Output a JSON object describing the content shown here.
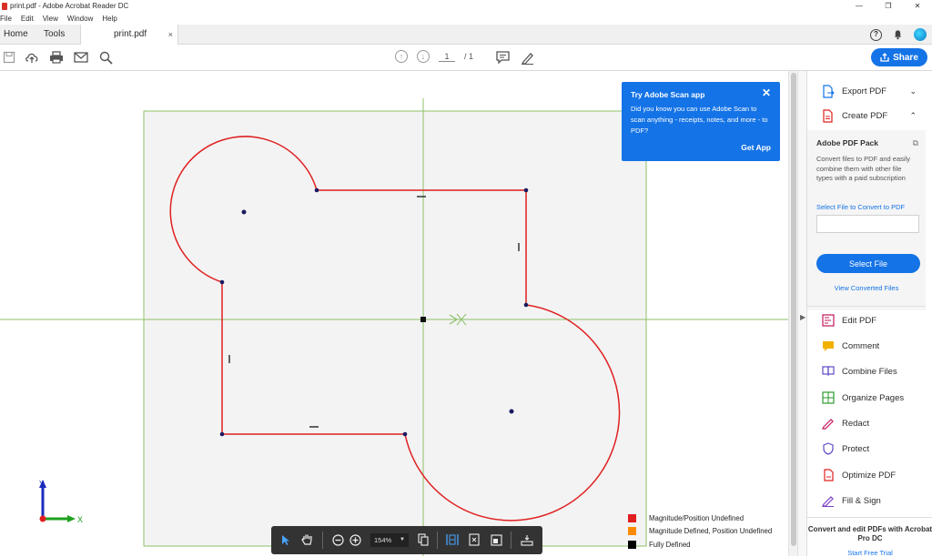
{
  "window": {
    "title": "print.pdf - Adobe Acrobat Reader DC",
    "controls": [
      "—",
      "❐",
      "✕"
    ]
  },
  "menu": [
    "File",
    "Edit",
    "View",
    "Window",
    "Help"
  ],
  "tabs": {
    "home": "Home",
    "tools": "Tools",
    "doc": "print.pdf",
    "close": "×"
  },
  "pager": {
    "current": "1",
    "total": "/ 1"
  },
  "share_label": "Share",
  "help_glyph": "?",
  "scan_popup": {
    "heading": "Try Adobe Scan app",
    "body": "Did you know you can use Adobe Scan to scan anything - receipts, notes, and more - to PDF?",
    "action": "Get App",
    "close": "✕"
  },
  "right_panel": {
    "export_pdf": "Export PDF",
    "create_pdf": "Create PDF",
    "pack_title": "Adobe PDF Pack",
    "pack_desc": "Convert files to PDF and easily combine them with other file types with a paid subscription",
    "select_label": "Select File to Convert to PDF",
    "select_button": "Select File",
    "view_converted": "View Converted Files",
    "tools": [
      "Edit PDF",
      "Comment",
      "Combine Files",
      "Organize Pages",
      "Redact",
      "Protect",
      "Optimize PDF",
      "Fill & Sign"
    ],
    "promo_title": "Convert and edit PDFs with Acrobat Pro DC",
    "promo_link": "Start Free Trial"
  },
  "legend": [
    {
      "label": "Magnitude/Position Undefined",
      "color": "#e02020"
    },
    {
      "label": "Magnitude Defined, Position Undefined",
      "color": "#ff8c00"
    },
    {
      "label": "Fully Defined",
      "color": "#000000"
    }
  ],
  "triad": {
    "y": "Y",
    "x": "X"
  },
  "bottom_toolbar": {
    "zoom": "154%"
  },
  "colors": {
    "accent": "#1473e6",
    "sketch_line": "#e02020",
    "construction": "#8cc06a"
  }
}
